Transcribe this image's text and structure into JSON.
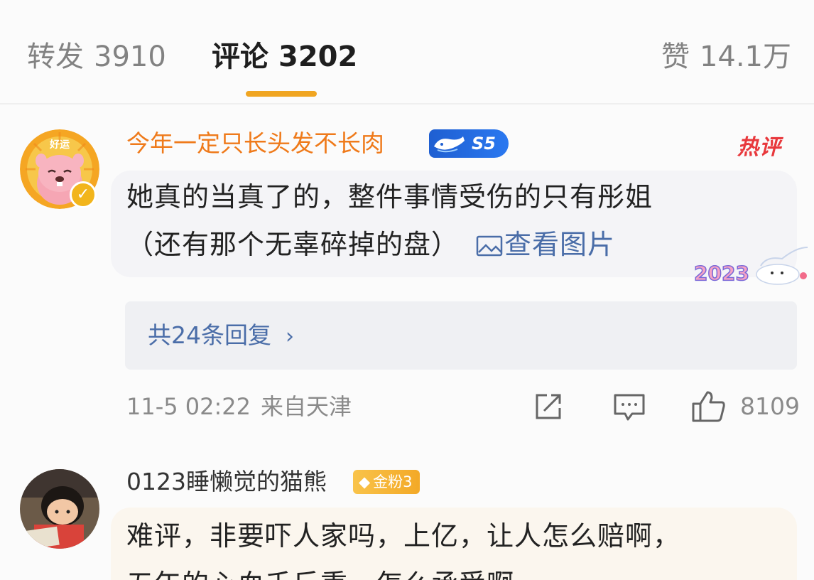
{
  "tabs": {
    "repost": {
      "label": "转发",
      "count": "3910"
    },
    "comment": {
      "label": "评论",
      "count": "3202"
    },
    "like": {
      "label": "赞",
      "count": "14.1万"
    }
  },
  "colors": {
    "accent_underline": "#f0a521",
    "username_highlight": "#ef7a1a",
    "link_blue": "#4a6da8",
    "hot_red": "#e8383c"
  },
  "comments": [
    {
      "username": "今年一定只长头发不长肉",
      "vip_level": "S5",
      "hot_tag": "热评",
      "avatar_label": "好运",
      "text_line1": "她真的当真了的，整件事情受伤的只有彤姐",
      "text_line2": "（还有那个无辜碎掉的盘）",
      "view_image": "查看图片",
      "sticker_text": "2023",
      "replies": "共24条回复",
      "time": "11-5 02:22",
      "location": "来自天津",
      "likes": "8109",
      "icons": [
        "share-icon",
        "comment-icon",
        "thumbs-up-icon",
        "verified-icon",
        "image-icon",
        "chevron-right-icon"
      ]
    },
    {
      "username": "0123睡懒觉的猫熊",
      "fan_badge": "金粉3",
      "text_line1": "难评，非要吓人家吗，上亿，让人怎么赔啊，",
      "text_line2": "五年的心血千斤重，怎么承受啊"
    }
  ]
}
